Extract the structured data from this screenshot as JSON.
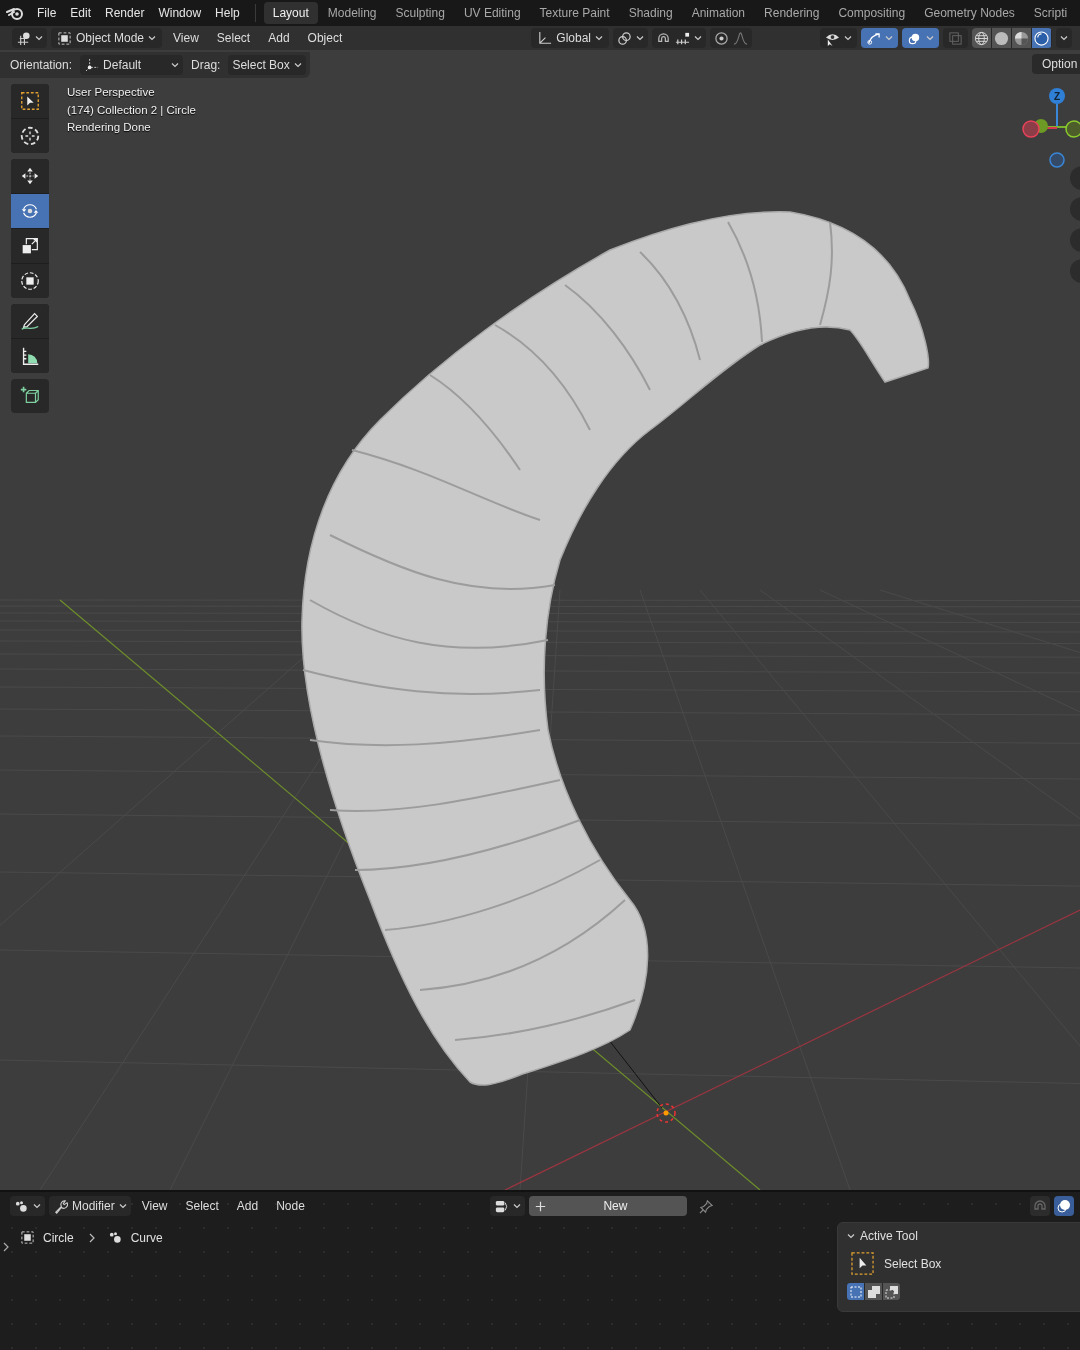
{
  "top_menu": [
    "File",
    "Edit",
    "Render",
    "Window",
    "Help"
  ],
  "workspace_tabs": [
    {
      "label": "Layout",
      "selected": true
    },
    {
      "label": "Modeling",
      "selected": false
    },
    {
      "label": "Sculpting",
      "selected": false
    },
    {
      "label": "UV Editing",
      "selected": false
    },
    {
      "label": "Texture Paint",
      "selected": false
    },
    {
      "label": "Shading",
      "selected": false
    },
    {
      "label": "Animation",
      "selected": false
    },
    {
      "label": "Rendering",
      "selected": false
    },
    {
      "label": "Compositing",
      "selected": false
    },
    {
      "label": "Geometry Nodes",
      "selected": false
    },
    {
      "label": "Scripti",
      "selected": false
    }
  ],
  "viewport_header": {
    "mode": "Object Mode",
    "menus": [
      "View",
      "Select",
      "Add",
      "Object"
    ],
    "orientation": "Global",
    "toggles": [
      {
        "kind": "visibility",
        "selected": false
      },
      {
        "kind": "gizmo",
        "selected": true
      },
      {
        "kind": "overlay",
        "selected": true
      },
      {
        "kind": "xray",
        "selected": false
      }
    ],
    "shading": [
      {
        "kind": "wireframe",
        "selected": false
      },
      {
        "kind": "solid",
        "selected": false
      },
      {
        "kind": "material",
        "selected": false
      },
      {
        "kind": "rendered",
        "selected": true
      }
    ]
  },
  "tool_settings": {
    "orientation_label": "Orientation:",
    "orientation": "Default",
    "drag_label": "Drag:",
    "drag": "Select Box",
    "options": "Option"
  },
  "tool_groups": [
    {
      "tools": [
        {
          "kind": "select",
          "selected": false
        },
        {
          "kind": "cursor",
          "selected": false
        }
      ]
    },
    {
      "tools": [
        {
          "kind": "move",
          "selected": false
        },
        {
          "kind": "rotate",
          "selected": true
        },
        {
          "kind": "scale",
          "selected": false
        },
        {
          "kind": "transform",
          "selected": false
        }
      ]
    },
    {
      "tools": [
        {
          "kind": "annotate",
          "selected": false
        },
        {
          "kind": "measure",
          "selected": false
        }
      ]
    },
    {
      "tools": [
        {
          "kind": "add_cube",
          "selected": false
        }
      ]
    }
  ],
  "viewport_info": [
    "User Perspective",
    "(174) Collection 2 | Circle",
    "Rendering Done"
  ],
  "gizmo": {
    "z_label": "Z"
  },
  "bottom_editor": {
    "context": "Modifier",
    "menus": [
      "View",
      "Select",
      "Add",
      "Node"
    ],
    "new_button": "New",
    "breadcrumb": [
      {
        "kind": "object",
        "label": "Circle"
      },
      {
        "kind": "curve",
        "label": "Curve"
      }
    ]
  },
  "active_tool_panel": {
    "title": "Active Tool",
    "expanded": true,
    "tool": "Select Box",
    "modes": [
      {
        "kind": "set",
        "selected": true
      },
      {
        "kind": "extend",
        "selected": false
      },
      {
        "kind": "subtract",
        "selected": false
      }
    ]
  }
}
